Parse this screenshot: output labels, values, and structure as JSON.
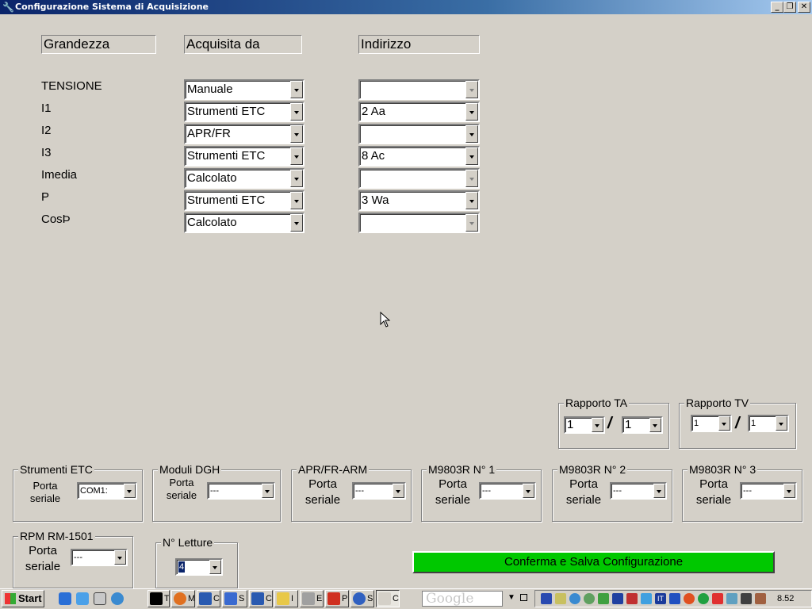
{
  "window": {
    "title": "Configurazione Sistema di Acquisizione"
  },
  "headers": {
    "grandezza": "Grandezza",
    "acquisita": "Acquisita da",
    "indirizzo": "Indirizzo"
  },
  "rows": [
    {
      "label": "TENSIONE",
      "source": "Manuale",
      "address": "",
      "address_enabled": false
    },
    {
      "label": "I1",
      "source": "Strumenti ETC",
      "address": "2 Aa",
      "address_enabled": true
    },
    {
      "label": "I2",
      "source": "APR/FR",
      "address": "",
      "address_enabled": true
    },
    {
      "label": "I3",
      "source": "Strumenti ETC",
      "address": "8 Ac",
      "address_enabled": true
    },
    {
      "label": "Imedia",
      "source": "Calcolato",
      "address": "",
      "address_enabled": false
    },
    {
      "label": "P",
      "source": "Strumenti ETC",
      "address": "3 Wa",
      "address_enabled": true
    },
    {
      "label": "CosÞ",
      "source": "Calcolato",
      "address": "",
      "address_enabled": false
    }
  ],
  "ratios": {
    "ta": {
      "title": "Rapporto TA",
      "num": "1",
      "den": "1",
      "sep": "/"
    },
    "tv": {
      "title": "Rapporto TV",
      "num": "1",
      "den": "1",
      "sep": "/"
    }
  },
  "devices": [
    {
      "title": "Strumenti ETC",
      "port_label_1": "Porta",
      "port_label_2": "seriale",
      "value": "COM1:"
    },
    {
      "title": "Moduli DGH",
      "port_label_1": "Porta",
      "port_label_2": "seriale",
      "value": "---"
    },
    {
      "title": "APR/FR-ARM",
      "port_label_1": "Porta",
      "port_label_2": "seriale",
      "value": "---"
    },
    {
      "title": "M9803R N° 1",
      "port_label_1": "Porta",
      "port_label_2": "seriale",
      "value": "---"
    },
    {
      "title": "M9803R N° 2",
      "port_label_1": "Porta",
      "port_label_2": "seriale",
      "value": "---"
    },
    {
      "title": "M9803R N° 3",
      "port_label_1": "Porta",
      "port_label_2": "seriale",
      "value": "---"
    }
  ],
  "rpm": {
    "title": "RPM RM-1501",
    "port_label_1": "Porta",
    "port_label_2": "seriale",
    "value": "---"
  },
  "letture": {
    "title": "N° Letture",
    "value": "4"
  },
  "confirm_label": "Conferma e Salva Configurazione",
  "confirm_color": "#00c800",
  "taskbar": {
    "start_label": "Start",
    "items": [
      "T",
      "M",
      "C",
      "S",
      "C",
      "I",
      "E",
      "P",
      "S",
      "C"
    ],
    "search_placeholder": "Google",
    "clock": "8.52"
  }
}
